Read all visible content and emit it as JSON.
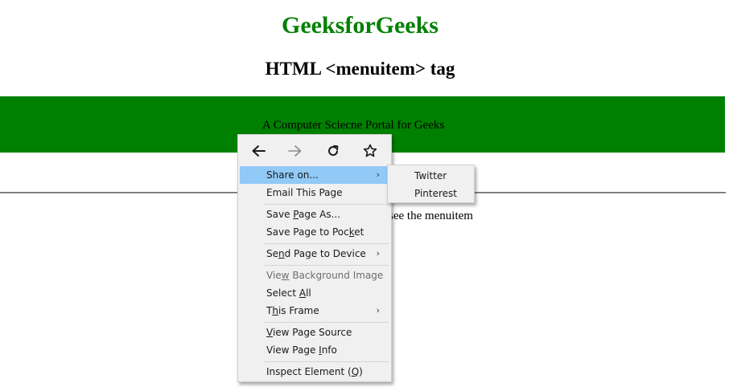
{
  "page": {
    "title": "GeeksforGeeks",
    "heading": "HTML <menuitem> tag",
    "banner_text": "A Computer Sciecne Portal for Geeks",
    "hint_text": "see the menuitem"
  },
  "context_menu": {
    "nav": {
      "back_icon": "back-arrow-icon",
      "forward_icon": "forward-arrow-icon",
      "reload_icon": "reload-icon",
      "bookmark_icon": "star-icon"
    },
    "items": {
      "share": {
        "pre": "Share on...",
        "u": "",
        "post": ""
      },
      "email": {
        "pre": "Email This Page",
        "u": "",
        "post": ""
      },
      "save_as": {
        "pre": "Save ",
        "u": "P",
        "post": "age As..."
      },
      "pocket": {
        "pre": "Save Page to Poc",
        "u": "k",
        "post": "et"
      },
      "send": {
        "pre": "Se",
        "u": "n",
        "post": "d Page to Device"
      },
      "view_bg": {
        "pre": "Vie",
        "u": "w",
        "post": " Background Image"
      },
      "select_all": {
        "pre": "Select ",
        "u": "A",
        "post": "ll"
      },
      "this_frame": {
        "pre": "T",
        "u": "h",
        "post": "is Frame"
      },
      "view_source": {
        "pre": "",
        "u": "V",
        "post": "iew Page Source"
      },
      "view_info": {
        "pre": "View Page ",
        "u": "I",
        "post": "nfo"
      },
      "inspect": {
        "pre": "Inspect Element (",
        "u": "Q",
        "post": ")"
      }
    },
    "submenu_arrow": "›"
  },
  "share_submenu": {
    "items": [
      "Twitter",
      "Pinterest"
    ]
  },
  "colors": {
    "brand_green": "#008000",
    "menu_bg": "#f0f0f0",
    "highlight": "#91c9f7"
  }
}
